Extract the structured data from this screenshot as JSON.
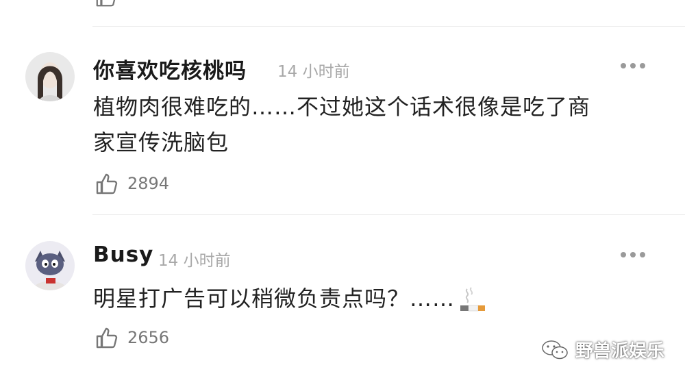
{
  "comments": [
    {
      "username": "你喜欢吃核桃吗",
      "time": "14 小时前",
      "text_line1": "植物肉很难吃的……不过她这个话术很像是吃了商",
      "text_line2": "家宣传洗脑包",
      "likes": "2894"
    },
    {
      "username": "Busy",
      "time": "14 小时前",
      "text_line1": "明星打广告可以稍微负责点吗？……",
      "likes": "2656"
    }
  ],
  "watermark": "野兽派娱乐",
  "icons": [
    "thumbs-up-icon",
    "more-icon",
    "cigarette-emoji",
    "wechat-icon"
  ]
}
